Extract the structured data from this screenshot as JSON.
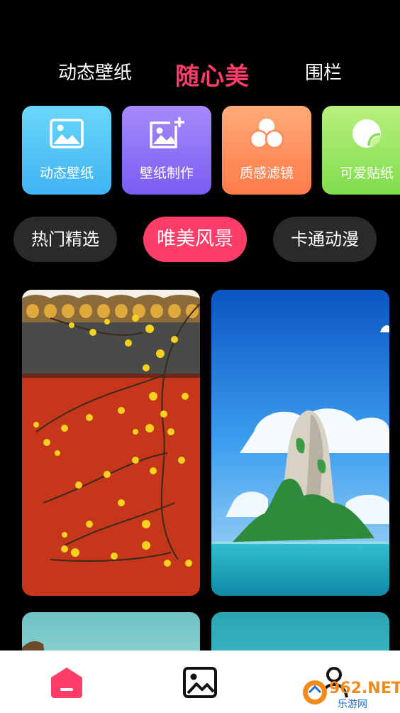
{
  "top_tabs": {
    "items": [
      "动态壁纸",
      "随心美",
      "围栏"
    ],
    "active_color": "#fe3e69"
  },
  "categories": [
    {
      "label": "动态壁纸",
      "icon": "image-icon"
    },
    {
      "label": "壁纸制作",
      "icon": "image-add-icon"
    },
    {
      "label": "质感滤镜",
      "icon": "filter-circles-icon"
    },
    {
      "label": "可爱贴纸",
      "icon": "sticker-icon"
    }
  ],
  "chips": {
    "items": [
      "热门精选",
      "唯美风景",
      "卡通动漫"
    ],
    "active_index": 1
  },
  "wallpapers": [
    {
      "name": "wintersweet-red-wall"
    },
    {
      "name": "island-rock-sea"
    },
    {
      "name": "teal-scene-1"
    },
    {
      "name": "teal-scene-2"
    }
  ],
  "bottom_nav": [
    {
      "icon": "home-icon",
      "active": true
    },
    {
      "icon": "gallery-icon",
      "active": false
    },
    {
      "icon": "profile-icon",
      "active": false
    }
  ],
  "watermark": {
    "main": "962.NET",
    "sub": "乐游网"
  }
}
